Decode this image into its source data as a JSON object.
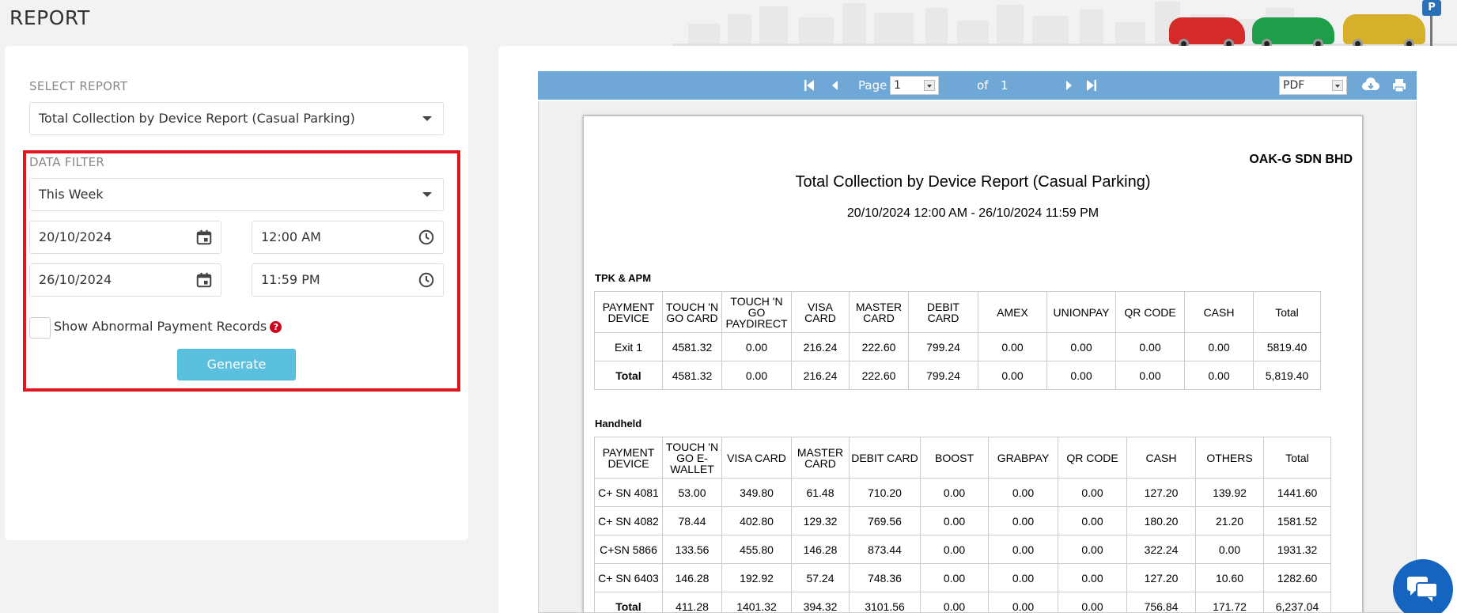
{
  "page": {
    "title": "REPORT"
  },
  "left": {
    "select_report_label": "SELECT REPORT",
    "select_report_value": "Total Collection by Device Report (Casual Parking)",
    "data_filter_label": "DATA FILTER",
    "period_value": "This Week",
    "start_date": "20/10/2024",
    "start_time": "12:00 AM",
    "end_date": "26/10/2024",
    "end_time": "11:59 PM",
    "abnormal_label": "Show Abnormal Payment Records",
    "generate_label": "Generate"
  },
  "toolbar": {
    "page_label": "Page",
    "page_value": "1",
    "of_label": "of",
    "total_pages": "1",
    "format_value": "PDF"
  },
  "report": {
    "company": "OAK-G SDN BHD",
    "title": "Total Collection by Device Report (Casual Parking)",
    "range": "20/10/2024 12:00 AM - 26/10/2024 11:59 PM",
    "section1": {
      "name": "TPK & APM",
      "headers": [
        "PAYMENT DEVICE",
        "TOUCH 'N GO CARD",
        "TOUCH 'N GO PAYDIRECT",
        "VISA CARD",
        "MASTER CARD",
        "DEBIT CARD",
        "AMEX",
        "UNIONPAY",
        "QR CODE",
        "CASH",
        "Total"
      ],
      "rows": [
        [
          "Exit 1",
          "4581.32",
          "0.00",
          "216.24",
          "222.60",
          "799.24",
          "0.00",
          "0.00",
          "0.00",
          "0.00",
          "5819.40"
        ],
        [
          "Total",
          "4581.32",
          "0.00",
          "216.24",
          "222.60",
          "799.24",
          "0.00",
          "0.00",
          "0.00",
          "0.00",
          "5,819.40"
        ]
      ]
    },
    "section2": {
      "name": "Handheld",
      "headers": [
        "PAYMENT DEVICE",
        "TOUCH 'N GO E-WALLET",
        "VISA CARD",
        "MASTER CARD",
        "DEBIT CARD",
        "BOOST",
        "GRABPAY",
        "QR CODE",
        "CASH",
        "OTHERS",
        "Total"
      ],
      "rows": [
        [
          "C+ SN 4081",
          "53.00",
          "349.80",
          "61.48",
          "710.20",
          "0.00",
          "0.00",
          "0.00",
          "127.20",
          "139.92",
          "1441.60"
        ],
        [
          "C+ SN 4082",
          "78.44",
          "402.80",
          "129.32",
          "769.56",
          "0.00",
          "0.00",
          "0.00",
          "180.20",
          "21.20",
          "1581.52"
        ],
        [
          "C+SN 5866",
          "133.56",
          "455.80",
          "146.28",
          "873.44",
          "0.00",
          "0.00",
          "0.00",
          "322.24",
          "0.00",
          "1931.32"
        ],
        [
          "C+ SN 6403",
          "146.28",
          "192.92",
          "57.24",
          "748.36",
          "0.00",
          "0.00",
          "0.00",
          "127.20",
          "10.60",
          "1282.60"
        ],
        [
          "Total",
          "411.28",
          "1401.32",
          "394.32",
          "3101.56",
          "0.00",
          "0.00",
          "0.00",
          "756.84",
          "171.72",
          "6,237.04"
        ]
      ]
    }
  },
  "icons": [
    "calendar-icon",
    "clock-icon",
    "help-icon",
    "first-page-icon",
    "prev-page-icon",
    "next-page-icon",
    "last-page-icon",
    "download-icon",
    "print-icon",
    "chat-icon"
  ],
  "colors": {
    "accent": "#5bc0de",
    "toolbar": "#6fa8d6",
    "highlight": "#e0151e",
    "chat": "#1565c0"
  }
}
